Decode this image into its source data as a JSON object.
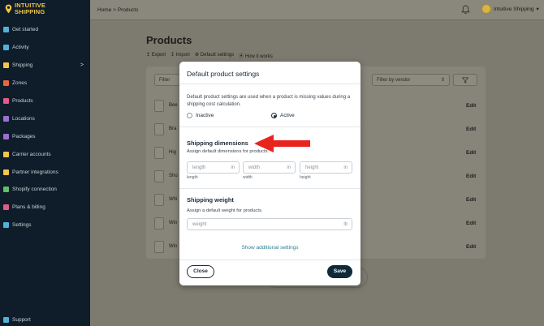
{
  "brand": {
    "line1": "INTUITIVE",
    "line2": "SHIPPING",
    "color": "#f3c64a"
  },
  "sidebar": {
    "items": [
      {
        "label": "Get started",
        "icon": "rocket-icon",
        "color": "#4fb3d9"
      },
      {
        "label": "Activity",
        "icon": "activity-icon",
        "color": "#4fb3d9"
      },
      {
        "label": "Shipping",
        "icon": "truck-icon",
        "color": "#f3c64a",
        "chevron": ">"
      },
      {
        "label": "Zones",
        "icon": "zones-icon",
        "color": "#e8673d"
      },
      {
        "label": "Products",
        "icon": "shirt-icon",
        "color": "#e05a8a"
      },
      {
        "label": "Locations",
        "icon": "locations-icon",
        "color": "#9b6fd1"
      },
      {
        "label": "Packages",
        "icon": "package-icon",
        "color": "#9b6fd1"
      },
      {
        "label": "Carrier accounts",
        "icon": "key-icon",
        "color": "#f3c64a"
      },
      {
        "label": "Partner integrations",
        "icon": "integrations-icon",
        "color": "#f3c64a"
      },
      {
        "label": "Shopify connection",
        "icon": "shopify-icon",
        "color": "#5fbf6a"
      },
      {
        "label": "Plans & billing",
        "icon": "billing-icon",
        "color": "#e05a8a"
      },
      {
        "label": "Settings",
        "icon": "gear-icon",
        "color": "#4fb3d9"
      }
    ],
    "support": {
      "label": "Support",
      "icon": "support-icon",
      "color": "#4fb3d9"
    }
  },
  "topbar": {
    "breadcrumb": "Home > Products",
    "user": "Intuitive Shipping",
    "user_chevron": "▾"
  },
  "page": {
    "title": "Products",
    "actions": [
      "↥ Export",
      "↧ Import",
      "⚙ Default settings",
      "⦿ How it works"
    ],
    "filters": {
      "left": "Filter",
      "vendor": "Filter by vendor"
    },
    "rows": [
      {
        "name": "Bee",
        "edit": "Edit"
      },
      {
        "name": "Bra",
        "edit": "Edit"
      },
      {
        "name": "Hig",
        "edit": "Edit"
      },
      {
        "name": "Sho",
        "edit": "Edit"
      },
      {
        "name": "Whi",
        "edit": "Edit"
      },
      {
        "name": "Win",
        "edit": "Edit"
      },
      {
        "name": "Win",
        "edit": "Edit"
      }
    ]
  },
  "modal": {
    "title": "Default product settings",
    "description": "Default product settings are used when a product is missing values during a shipping cost calculation.",
    "radio": {
      "inactive": "Inactive",
      "active": "Active",
      "selected": "active"
    },
    "dimensions": {
      "title": "Shipping dimensions",
      "subtitle": "Assign default dimensions for products.",
      "fields": [
        {
          "placeholder": "length",
          "unit": "in",
          "label": "length"
        },
        {
          "placeholder": "width",
          "unit": "in",
          "label": "width"
        },
        {
          "placeholder": "height",
          "unit": "in",
          "label": "height"
        }
      ]
    },
    "weight": {
      "title": "Shipping weight",
      "subtitle": "Assign a default weight for products.",
      "placeholder": "weight",
      "unit": "lb"
    },
    "additional_link": "Show additional settings",
    "close_label": "Close",
    "save_label": "Save"
  },
  "colors": {
    "save_button": "#0e2a3a",
    "link": "#2a7f93",
    "annotation_arrow": "#e8251d"
  }
}
